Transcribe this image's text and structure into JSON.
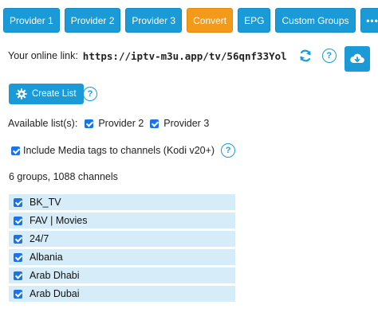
{
  "tabs": [
    {
      "label": "Provider 1",
      "active": false
    },
    {
      "label": "Provider 2",
      "active": false
    },
    {
      "label": "Provider 3",
      "active": false
    },
    {
      "label": "Convert",
      "active": true
    },
    {
      "label": "EPG",
      "active": false
    },
    {
      "label": "Custom Groups",
      "active": false
    },
    {
      "label": "•••",
      "active": false
    }
  ],
  "link": {
    "label": "Your online link:",
    "url": "https://iptv-m3u.app/tv/56qnf33Yol",
    "refresh_icon": "refresh-icon",
    "help_icon": "question-circle-icon"
  },
  "cloud_download_icon": "cloud-download-icon",
  "create_list": {
    "label": "Create List",
    "icon": "gear-icon"
  },
  "available": {
    "label": "Available list(s):",
    "lists": [
      {
        "label": "Provider 2",
        "checked": true
      },
      {
        "label": "Provider 3",
        "checked": true
      }
    ]
  },
  "media_tags": {
    "label": "Include Media tags to channels (Kodi v20+)",
    "checked": true
  },
  "summary": "6 groups, 1088 channels",
  "groups": [
    {
      "label": "BK_TV",
      "checked": true
    },
    {
      "label": "FAV | Movies",
      "checked": true
    },
    {
      "label": "24/7",
      "checked": true
    },
    {
      "label": "Albania",
      "checked": true
    },
    {
      "label": "Arab Dhabi",
      "checked": true
    },
    {
      "label": "Arab Dubai",
      "checked": true
    }
  ],
  "colors": {
    "primary": "#1a9bd7",
    "active_tab": "#f39a1a",
    "row_bg": "#d6ecf9",
    "checkbox": "#1a73e8"
  }
}
